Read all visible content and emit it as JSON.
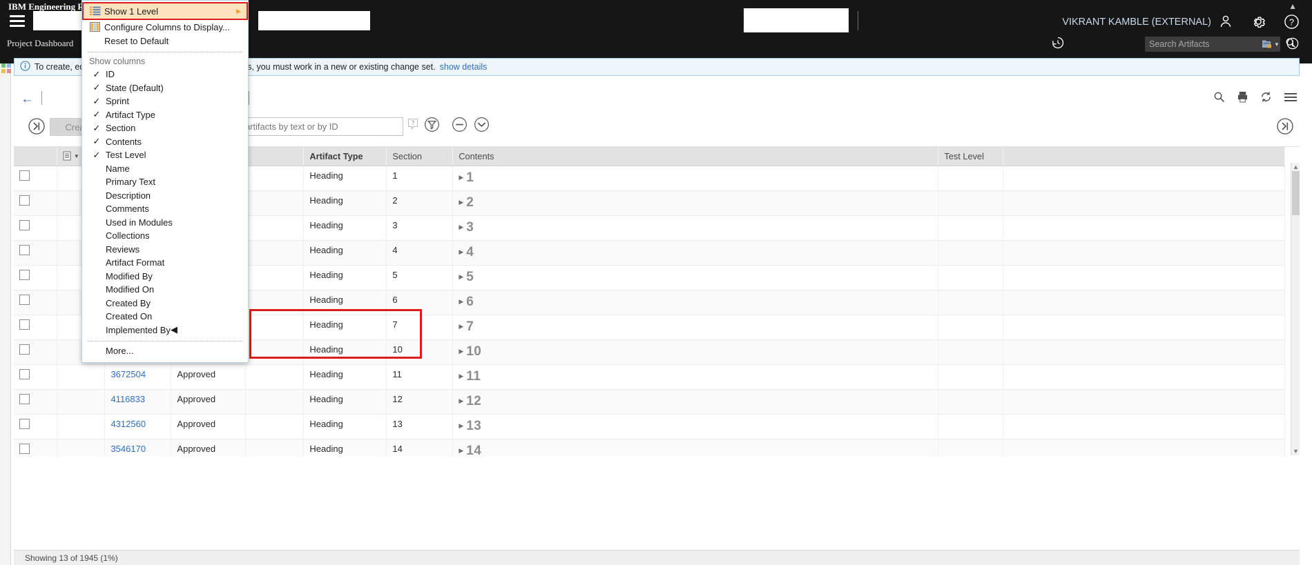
{
  "banner": {
    "brand": "IBM Engineering Requi",
    "project_dashboard": "Project Dashboard",
    "user_name": "VIKRANT KAMBLE (EXTERNAL)",
    "icons": {
      "hamburger": "hamburger-icon",
      "user": "user-icon",
      "gear": "gear-icon",
      "help": "help-icon",
      "history": "history-icon",
      "info": "info-icon",
      "collapse": "chevron-up-icon"
    }
  },
  "search": {
    "placeholder": "Search Artifacts",
    "value": ""
  },
  "info_banner": {
    "text_start": "To create, ed",
    "text_end": "s, you must work in a new or existing change set.",
    "link": "show details"
  },
  "toolbar": {
    "create_label": "Create",
    "filter_placeholder": "ype to filter artifacts by text or by ID",
    "filter_value": ""
  },
  "context_menu": {
    "items": [
      {
        "label": "Show 1 Level",
        "icon": "levels-icon",
        "highlighted": true,
        "submenu": true
      },
      {
        "label": "Configure Columns to Display...",
        "icon": "columns-icon",
        "highlighted": false,
        "submenu": false
      },
      {
        "label": "Reset to Default",
        "icon": "",
        "highlighted": false,
        "submenu": false
      }
    ],
    "group_label": "Show columns",
    "columns": [
      {
        "label": "ID",
        "checked": true,
        "submenu": false
      },
      {
        "label": "State (Default)",
        "checked": true,
        "submenu": false
      },
      {
        "label": "Sprint",
        "checked": true,
        "submenu": false
      },
      {
        "label": "Artifact Type",
        "checked": true,
        "submenu": false
      },
      {
        "label": "Section",
        "checked": true,
        "submenu": false
      },
      {
        "label": "Contents",
        "checked": true,
        "submenu": false
      },
      {
        "label": "Test Level",
        "checked": true,
        "submenu": false
      },
      {
        "label": "Name",
        "checked": false,
        "submenu": false
      },
      {
        "label": "Primary Text",
        "checked": false,
        "submenu": false
      },
      {
        "label": "Description",
        "checked": false,
        "submenu": false
      },
      {
        "label": "Comments",
        "checked": false,
        "submenu": false
      },
      {
        "label": "Used in Modules",
        "checked": false,
        "submenu": false
      },
      {
        "label": "Collections",
        "checked": false,
        "submenu": false
      },
      {
        "label": "Reviews",
        "checked": false,
        "submenu": false
      },
      {
        "label": "Artifact Format",
        "checked": false,
        "submenu": false
      },
      {
        "label": "Modified By",
        "checked": false,
        "submenu": false
      },
      {
        "label": "Modified On",
        "checked": false,
        "submenu": false
      },
      {
        "label": "Created By",
        "checked": false,
        "submenu": false
      },
      {
        "label": "Created On",
        "checked": false,
        "submenu": false
      },
      {
        "label": "Implemented By",
        "checked": false,
        "submenu": true
      }
    ],
    "more_label": "More..."
  },
  "table": {
    "headers": [
      "",
      "",
      "",
      "",
      "",
      "Artifact Type",
      "Section",
      "Contents",
      "Test Level",
      ""
    ],
    "rows": [
      {
        "id": "",
        "state": "",
        "sprint": "",
        "type": "Heading",
        "section": "1",
        "contents": "1",
        "test_level": ""
      },
      {
        "id": "",
        "state": "",
        "sprint": "",
        "type": "Heading",
        "section": "2",
        "contents": "2",
        "test_level": ""
      },
      {
        "id": "",
        "state": "",
        "sprint": "",
        "type": "Heading",
        "section": "3",
        "contents": "3",
        "test_level": ""
      },
      {
        "id": "",
        "state": "",
        "sprint": "",
        "type": "Heading",
        "section": "4",
        "contents": "4",
        "test_level": ""
      },
      {
        "id": "",
        "state": "",
        "sprint": "",
        "type": "Heading",
        "section": "5",
        "contents": "5",
        "test_level": ""
      },
      {
        "id": "",
        "state": "",
        "sprint": "",
        "type": "Heading",
        "section": "6",
        "contents": "6",
        "test_level": ""
      },
      {
        "id": "",
        "state": "",
        "sprint": "",
        "type": "Heading",
        "section": "7",
        "contents": "7",
        "test_level": ""
      },
      {
        "id": "",
        "state": "",
        "sprint": "",
        "type": "Heading",
        "section": "10",
        "contents": "10",
        "test_level": ""
      },
      {
        "id": "3672504",
        "state": "Approved",
        "sprint": "",
        "type": "Heading",
        "section": "11",
        "contents": "11",
        "test_level": ""
      },
      {
        "id": "4116833",
        "state": "Approved",
        "sprint": "",
        "type": "Heading",
        "section": "12",
        "contents": "12",
        "test_level": ""
      },
      {
        "id": "4312560",
        "state": "Approved",
        "sprint": "",
        "type": "Heading",
        "section": "13",
        "contents": "13",
        "test_level": ""
      },
      {
        "id": "3546170",
        "state": "Approved",
        "sprint": "",
        "type": "Heading",
        "section": "14",
        "contents": "14",
        "test_level": ""
      }
    ]
  },
  "status": {
    "text": "Showing 13 of 1945 (1%)"
  },
  "colors": {
    "banner_bg": "#161616",
    "highlight_bg": "#fde3bd",
    "annotation_red": "#e01b1b",
    "link_blue": "#2f6fc4",
    "submenu_arrow": "#f0a030"
  }
}
